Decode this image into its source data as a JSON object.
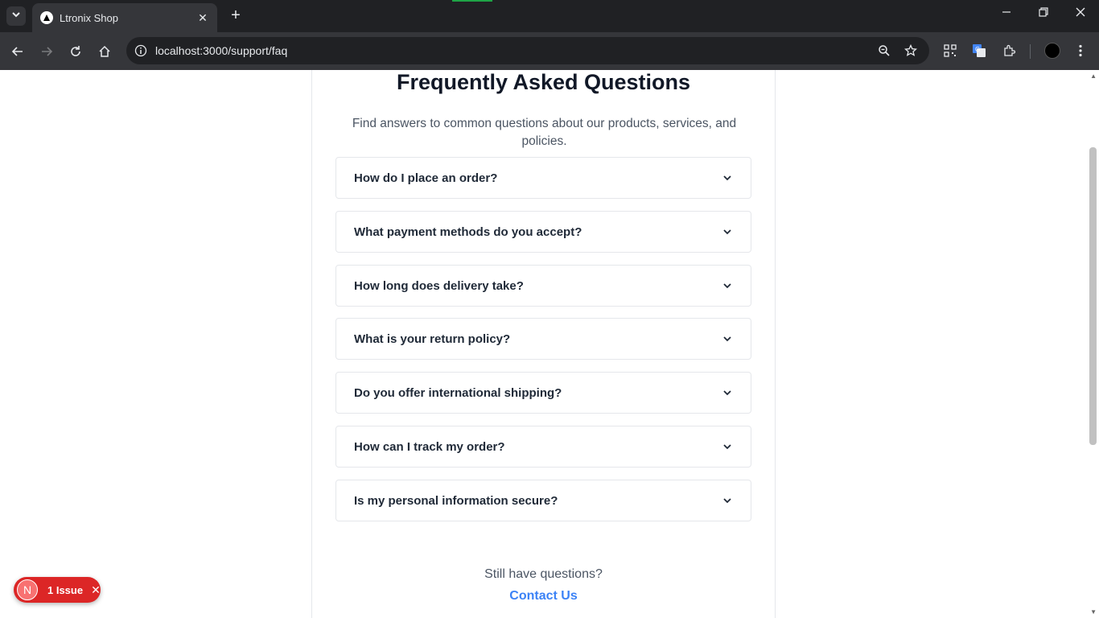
{
  "browser": {
    "tab_title": "Ltronix Shop",
    "url": "localhost:3000/support/faq"
  },
  "page": {
    "title": "Frequently Asked Questions",
    "subtitle": "Find answers to common questions about our products, services, and policies.",
    "faqs": [
      {
        "question": "How do I place an order?"
      },
      {
        "question": "What payment methods do you accept?"
      },
      {
        "question": "How long does delivery take?"
      },
      {
        "question": "What is your return policy?"
      },
      {
        "question": "Do you offer international shipping?"
      },
      {
        "question": "How can I track my order?"
      },
      {
        "question": "Is my personal information secure?"
      }
    ],
    "still_have_questions": "Still have questions?",
    "contact_link": "Contact Us"
  },
  "devtools": {
    "logo": "N",
    "issue_label": "1 Issue"
  },
  "colors": {
    "accent_link": "#3b82f6",
    "issue_badge": "#dc2626"
  }
}
